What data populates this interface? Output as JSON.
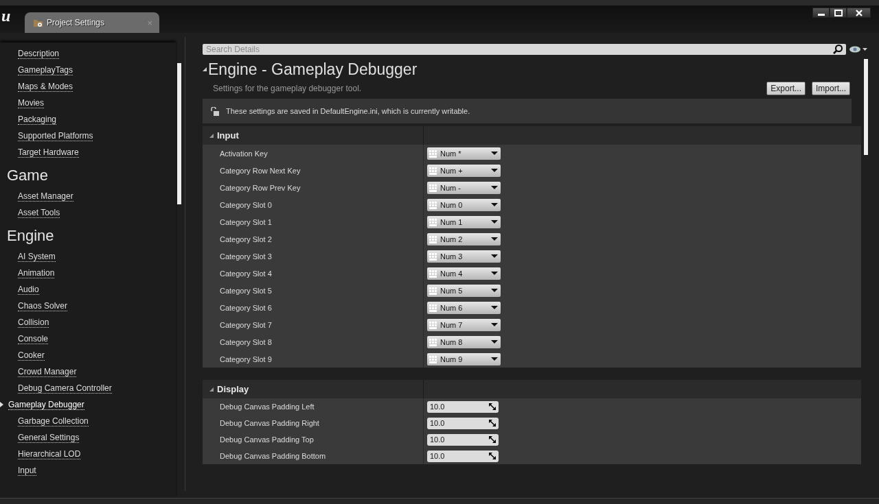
{
  "app": {
    "logo": "u"
  },
  "tab": {
    "label": "Project Settings",
    "close": "×"
  },
  "sidebar": {
    "groups": [
      {
        "items": [
          {
            "label": "Description",
            "selected": false
          },
          {
            "label": "GameplayTags",
            "selected": false
          },
          {
            "label": "Maps & Modes",
            "selected": false
          },
          {
            "label": "Movies",
            "selected": false
          },
          {
            "label": "Packaging",
            "selected": false
          },
          {
            "label": "Supported Platforms",
            "selected": false
          },
          {
            "label": "Target Hardware",
            "selected": false
          }
        ]
      },
      {
        "heading": "Game",
        "items": [
          {
            "label": "Asset Manager",
            "selected": false
          },
          {
            "label": "Asset Tools",
            "selected": false
          }
        ]
      },
      {
        "heading": "Engine",
        "items": [
          {
            "label": "AI System",
            "selected": false
          },
          {
            "label": "Animation",
            "selected": false
          },
          {
            "label": "Audio",
            "selected": false
          },
          {
            "label": "Chaos Solver",
            "selected": false
          },
          {
            "label": "Collision",
            "selected": false
          },
          {
            "label": "Console",
            "selected": false
          },
          {
            "label": "Cooker",
            "selected": false
          },
          {
            "label": "Crowd Manager",
            "selected": false
          },
          {
            "label": "Debug Camera Controller",
            "selected": false
          },
          {
            "label": "Gameplay Debugger",
            "selected": true
          },
          {
            "label": "Garbage Collection",
            "selected": false
          },
          {
            "label": "General Settings",
            "selected": false
          },
          {
            "label": "Hierarchical LOD",
            "selected": false
          },
          {
            "label": "Input",
            "selected": false
          }
        ]
      }
    ]
  },
  "search": {
    "placeholder": "Search Details"
  },
  "header": {
    "title": "Engine - Gameplay Debugger",
    "subtitle": "Settings for the gameplay debugger tool.",
    "buttons": [
      "Export...",
      "Import..."
    ]
  },
  "notice": "These settings are saved in DefaultEngine.ini, which is currently writable.",
  "sections": [
    {
      "title": "Input",
      "expanded": true,
      "rows": [
        {
          "kind": "key",
          "label": "Activation Key",
          "value": "Num *"
        },
        {
          "kind": "key",
          "label": "Category Row Next Key",
          "value": "Num +"
        },
        {
          "kind": "key",
          "label": "Category Row Prev Key",
          "value": "Num -"
        },
        {
          "kind": "key",
          "label": "Category Slot 0",
          "value": "Num 0"
        },
        {
          "kind": "key",
          "label": "Category Slot 1",
          "value": "Num 1"
        },
        {
          "kind": "key",
          "label": "Category Slot 2",
          "value": "Num 2"
        },
        {
          "kind": "key",
          "label": "Category Slot 3",
          "value": "Num 3"
        },
        {
          "kind": "key",
          "label": "Category Slot 4",
          "value": "Num 4"
        },
        {
          "kind": "key",
          "label": "Category Slot 5",
          "value": "Num 5"
        },
        {
          "kind": "key",
          "label": "Category Slot 6",
          "value": "Num 6"
        },
        {
          "kind": "key",
          "label": "Category Slot 7",
          "value": "Num 7"
        },
        {
          "kind": "key",
          "label": "Category Slot 8",
          "value": "Num 8"
        },
        {
          "kind": "key",
          "label": "Category Slot 9",
          "value": "Num 9"
        }
      ]
    },
    {
      "title": "Display",
      "expanded": true,
      "rows": [
        {
          "kind": "number",
          "label": "Debug Canvas Padding Left",
          "value": "10.0"
        },
        {
          "kind": "number",
          "label": "Debug Canvas Padding Right",
          "value": "10.0"
        },
        {
          "kind": "number",
          "label": "Debug Canvas Padding Top",
          "value": "10.0"
        },
        {
          "kind": "number",
          "label": "Debug Canvas Padding Bottom",
          "value": "10.0"
        }
      ]
    }
  ]
}
